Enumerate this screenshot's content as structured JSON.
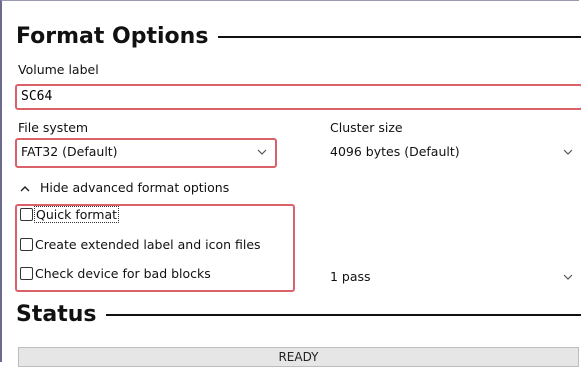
{
  "format_options": {
    "heading": "Format Options",
    "volume_label": {
      "label": "Volume label",
      "value": "SC64"
    },
    "file_system": {
      "label": "File system",
      "selected": "FAT32 (Default)"
    },
    "cluster_size": {
      "label": "Cluster size",
      "selected": "4096 bytes (Default)"
    },
    "advanced_toggle": {
      "label": "Hide advanced format options",
      "icon": "chevron-up-icon"
    },
    "options": {
      "quick_format": {
        "label": "Quick format",
        "checked": false
      },
      "extended_label": {
        "label": "Create extended label and icon files",
        "checked": false
      },
      "bad_blocks": {
        "label": "Check device for bad blocks",
        "checked": false
      }
    },
    "passes": {
      "selected": "1 pass"
    }
  },
  "status": {
    "heading": "Status",
    "text": "READY"
  },
  "colors": {
    "highlight": "#d9616a",
    "text": "#111111",
    "status_bar_bg": "#e6e6e6"
  }
}
